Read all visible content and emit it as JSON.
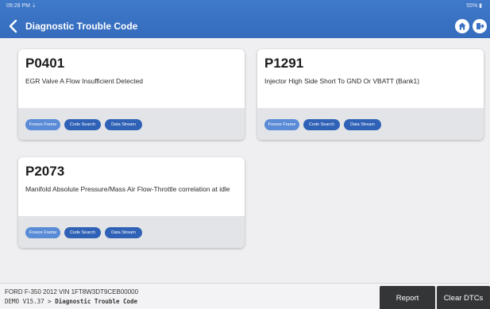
{
  "status": {
    "time": "09:28 PM  ⇣",
    "battery": "55% ▮"
  },
  "header": {
    "title": "Diagnostic Trouble Code"
  },
  "codes": [
    {
      "code": "P0401",
      "description": "EGR Valve A Flow Insufficient Detected",
      "buttons": [
        "Freeze Frame",
        "Code Search",
        "Data Stream"
      ]
    },
    {
      "code": "P1291",
      "description": "Injector High Side Short To GND Or VBATT (Bank1)",
      "buttons": [
        "Freeze Frame",
        "Code Search",
        "Data Stream"
      ]
    },
    {
      "code": "P2073",
      "description": "Manifold Absolute Pressure/Mass Air Flow-Throttle correlation at idle",
      "buttons": [
        "Freeze Frame",
        "Code Search",
        "Data Stream"
      ]
    }
  ],
  "footer": {
    "vehicle": "FORD  F-350  2012  VIN  1FT8W3DT9CEB00000",
    "path_prefix": "DEMO V15.37 > ",
    "path_current": "Diagnostic Trouble Code",
    "report_label": "Report",
    "clear_label": "Clear DTCs"
  },
  "colors": {
    "header": "#3f79c9",
    "button_dark": "#2f62b6",
    "button_light": "#5a8bd6",
    "footer_button": "#343537"
  },
  "icons": {
    "back": "chevron-left-icon",
    "home": "home-icon",
    "exit": "exit-icon"
  }
}
